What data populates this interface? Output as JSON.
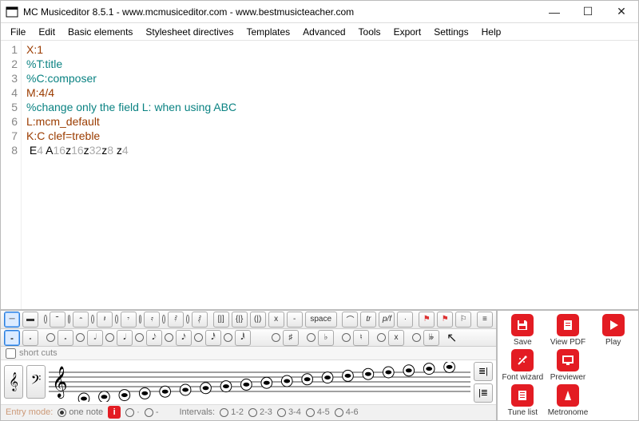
{
  "window": {
    "title": "MC Musiceditor 8.5.1 - www.mcmusiceditor.com - www.bestmusicteacher.com"
  },
  "menu": [
    "File",
    "Edit",
    "Basic elements",
    "Stylesheet directives",
    "Templates",
    "Advanced",
    "Tools",
    "Export",
    "Settings",
    "Help"
  ],
  "editor": {
    "lines": [
      {
        "n": "1",
        "seg": [
          {
            "c": "brown",
            "t": "X:1"
          }
        ]
      },
      {
        "n": "2",
        "seg": [
          {
            "c": "teal",
            "t": "%T:title"
          }
        ]
      },
      {
        "n": "3",
        "seg": [
          {
            "c": "teal",
            "t": "%C:composer"
          }
        ]
      },
      {
        "n": "4",
        "seg": [
          {
            "c": "brown",
            "t": "M:4/4"
          }
        ]
      },
      {
        "n": "5",
        "seg": [
          {
            "c": "teal",
            "t": "%change only the field L: when using ABC"
          }
        ]
      },
      {
        "n": "6",
        "seg": [
          {
            "c": "brown",
            "t": "L:mcm_default"
          }
        ]
      },
      {
        "n": "7",
        "seg": [
          {
            "c": "brown",
            "t": "K:C clef=treble"
          }
        ]
      },
      {
        "n": "8",
        "seg": [
          {
            "c": "black",
            "t": " E"
          },
          {
            "c": "gray",
            "t": "4 "
          },
          {
            "c": "black",
            "t": "A"
          },
          {
            "c": "gray",
            "t": "16"
          },
          {
            "c": "black",
            "t": "z"
          },
          {
            "c": "gray",
            "t": "16"
          },
          {
            "c": "black",
            "t": "z"
          },
          {
            "c": "gray",
            "t": "32"
          },
          {
            "c": "black",
            "t": "z"
          },
          {
            "c": "gray",
            "t": "8"
          },
          {
            "c": "black",
            "t": " z"
          },
          {
            "c": "gray",
            "t": "4"
          }
        ]
      }
    ]
  },
  "toolbar": {
    "row1": {
      "rests": [
        "─",
        "▬",
        "𝄻",
        "𝄼",
        "𝄽",
        "𝄾",
        "𝄿",
        "𝅀",
        "𝅁"
      ],
      "bar_groups": [
        "[|]",
        "{|}",
        "(|)",
        "x",
        "-",
        "space"
      ],
      "dynamics": [
        "⌒",
        "tr",
        "p/f",
        "·"
      ],
      "flags": [
        "⚑",
        "⚑",
        "⚐"
      ],
      "misc": [
        "≡"
      ]
    },
    "row2": {
      "notes": [
        "𝅝",
        "𝅗",
        "𝅗𝅥",
        "𝅘𝅥",
        "𝅘𝅥𝅮",
        "𝅘𝅥𝅯",
        "𝅘𝅥𝅰",
        "𝅘𝅥𝅱"
      ],
      "accidentals": [
        "♯",
        "♭",
        "♮",
        "x",
        "𝄫"
      ]
    }
  },
  "shortcuts_label": "short cuts",
  "clefs": {
    "treble": "𝄞",
    "bass": "𝄢"
  },
  "staff_side": {
    "a": "≣|",
    "b": "|≣"
  },
  "entry": {
    "label": "Entry mode:",
    "one_note": "one note",
    "dot": "·",
    "dash": "-",
    "intervals_label": "Intervals:",
    "intervals": [
      "1-2",
      "2-3",
      "3-4",
      "4-5",
      "4-6"
    ]
  },
  "actions": {
    "save": "Save",
    "viewpdf": "View PDF",
    "play": "Play",
    "fontwizard": "Font wizard",
    "previewer": "Previewer",
    "tunelist": "Tune list",
    "metronome": "Metronome"
  }
}
